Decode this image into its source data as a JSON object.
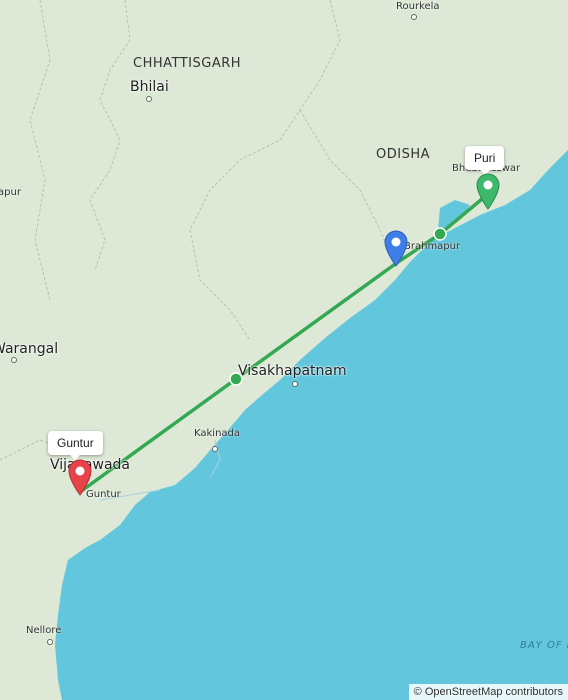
{
  "map": {
    "labels": {
      "rourkela": "Rourkela",
      "chhattisgarh": "CHHATTISGARH",
      "bhilai": "Bhilai",
      "odisha": "ODISHA",
      "bhubaneswar": "Bhubaneswar",
      "brahmapur": "Brahmapur",
      "warangal": "Warangal",
      "apur": "apur",
      "visakhapatnam": "Visakhapatnam",
      "kakinada": "Kakinada",
      "vijayawada": "Vijayawada",
      "guntur": "Guntur",
      "nellore": "Nellore",
      "bay_of_bengal": "BAY OF BENGAL"
    },
    "markers": {
      "start": {
        "label": "Guntur",
        "color": "#e8434b"
      },
      "end": {
        "label": "Puri",
        "color": "#3cb96a"
      },
      "current": {
        "color": "#3f7ee8"
      }
    },
    "route_color": "#34a853",
    "colors": {
      "land": "#dde9d6",
      "sea": "#62c6dc",
      "border": "#b9c4b1"
    },
    "attribution": "© OpenStreetMap contributors"
  }
}
